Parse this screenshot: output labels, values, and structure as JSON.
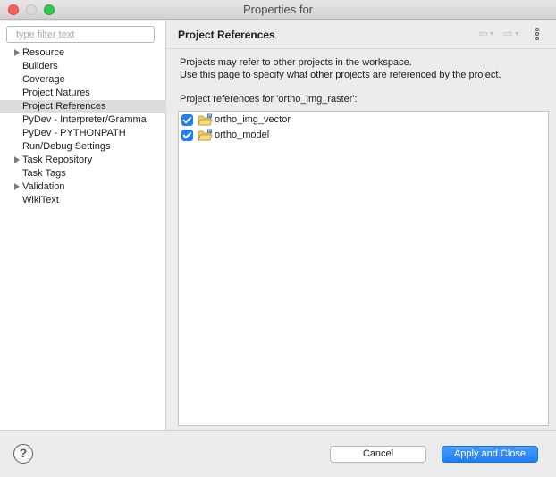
{
  "window": {
    "title": "Properties for"
  },
  "filter": {
    "placeholder": "type filter text",
    "value": ""
  },
  "tree": {
    "items": [
      {
        "label": "Resource",
        "expandable": true,
        "selected": false
      },
      {
        "label": "Builders",
        "expandable": false,
        "selected": false
      },
      {
        "label": "Coverage",
        "expandable": false,
        "selected": false
      },
      {
        "label": "Project Natures",
        "expandable": false,
        "selected": false
      },
      {
        "label": "Project References",
        "expandable": false,
        "selected": true
      },
      {
        "label": "PyDev - Interpreter/Gramma",
        "expandable": false,
        "selected": false
      },
      {
        "label": "PyDev - PYTHONPATH",
        "expandable": false,
        "selected": false
      },
      {
        "label": "Run/Debug Settings",
        "expandable": false,
        "selected": false
      },
      {
        "label": "Task Repository",
        "expandable": true,
        "selected": false
      },
      {
        "label": "Task Tags",
        "expandable": false,
        "selected": false
      },
      {
        "label": "Validation",
        "expandable": true,
        "selected": false
      },
      {
        "label": "WikiText",
        "expandable": false,
        "selected": false
      }
    ]
  },
  "page": {
    "title": "Project References",
    "description_line1": "Projects may refer to other projects in the workspace.",
    "description_line2": "Use this page to specify what other projects are referenced by the project.",
    "refs_label": "Project references for 'ortho_img_raster':",
    "references": [
      {
        "name": "ortho_img_vector",
        "checked": true
      },
      {
        "name": "ortho_model",
        "checked": true
      }
    ]
  },
  "icons": {
    "back": "back-arrow-icon",
    "forward": "forward-arrow-icon",
    "menu": "view-menu-icon",
    "help": "help-icon",
    "project": "project-folder-icon"
  },
  "buttons": {
    "help": "?",
    "cancel": "Cancel",
    "apply": "Apply and Close"
  },
  "colors": {
    "accent": "#1e7ef7",
    "selection": "#dcdcdc"
  }
}
